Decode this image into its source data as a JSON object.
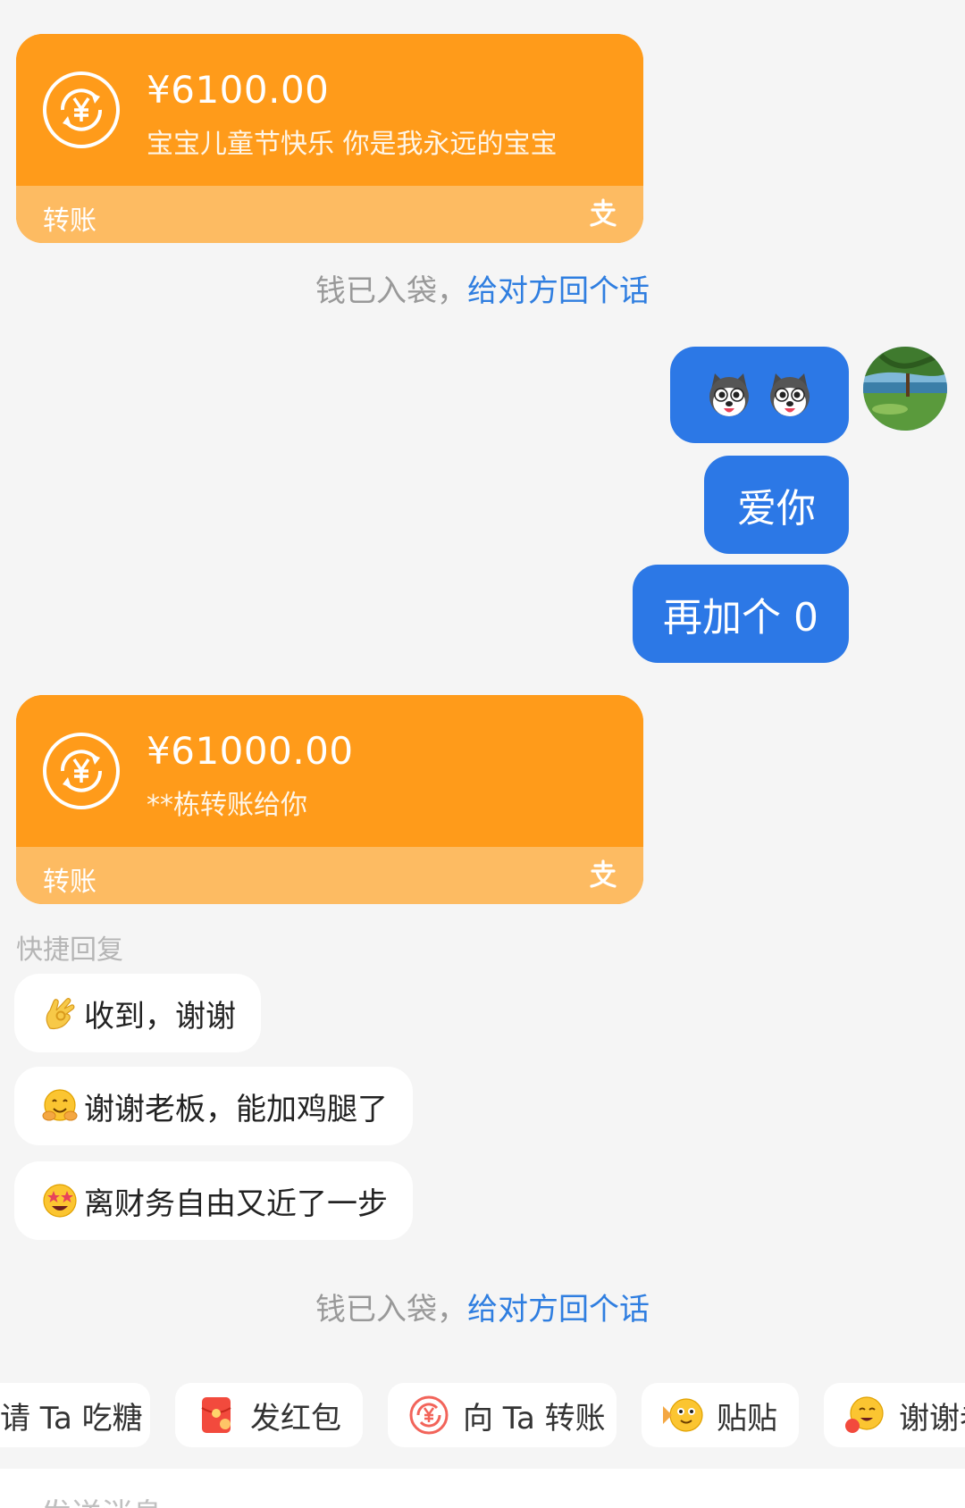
{
  "transfers": [
    {
      "amount": "¥6100.00",
      "memo": "宝宝儿童节快乐 你是我永远的宝宝",
      "footer_label": "转账",
      "icon": "yuan-transfer-icon",
      "brand_icon": "alipay-zhi-icon"
    },
    {
      "amount": "¥61000.00",
      "memo": "**栋转账给你",
      "footer_label": "转账",
      "icon": "yuan-transfer-icon",
      "brand_icon": "alipay-zhi-icon"
    }
  ],
  "system_notes": [
    {
      "grey": "钱已入袋，",
      "link": "给对方回个话"
    },
    {
      "grey": "钱已入袋，",
      "link": "给对方回个话"
    }
  ],
  "messages": [
    {
      "type": "sticker",
      "content": "husky-sticker x2"
    },
    {
      "type": "text",
      "content": "爱你"
    },
    {
      "type": "text",
      "content": "再加个 0"
    }
  ],
  "quick_reply": {
    "title": "快捷回复",
    "items": [
      {
        "emoji": "ok-hand-icon",
        "text": "收到，谢谢"
      },
      {
        "emoji": "hugging-face-icon",
        "text": "谢谢老板，能加鸡腿了"
      },
      {
        "emoji": "star-struck-face-icon",
        "text": "离财务自由又近了一步"
      }
    ]
  },
  "actions": [
    {
      "label": "请 Ta 吃糖",
      "icon": "candy-icon"
    },
    {
      "label": "发红包",
      "icon": "red-packet-icon"
    },
    {
      "label": "向 Ta 转账",
      "icon": "transfer-icon"
    },
    {
      "label": "贴贴",
      "icon": "cuddle-face-icon"
    },
    {
      "label": "谢谢老",
      "icon": "thanks-face-icon"
    }
  ],
  "input": {
    "placeholder": "发送消息"
  },
  "colors": {
    "transfer_orange": "#ff9b1a",
    "transfer_footer": "#fdbb62",
    "bubble_blue": "#2c78e6",
    "link_blue": "#2f7ee0",
    "background": "#f5f5f5"
  }
}
